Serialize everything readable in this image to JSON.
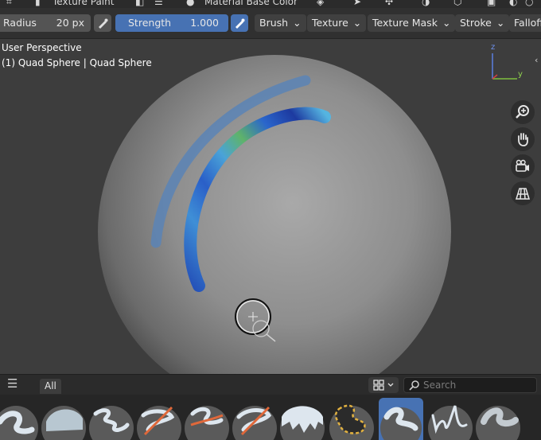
{
  "topbar": {
    "mode": "Texture Paint",
    "source": "Material Base Color"
  },
  "header": {
    "radius_label": "Radius",
    "radius_value": "20 px",
    "strength_label": "Strength",
    "strength_value": "1.000",
    "menus": [
      "Brush",
      "Texture",
      "Texture Mask",
      "Stroke",
      "Falloff"
    ]
  },
  "viewport": {
    "perspective": "User Perspective",
    "object": "(1) Quad Sphere | Quad Sphere",
    "gizmo": {
      "z": "z",
      "y": "y"
    },
    "nav_icons": [
      "zoom-icon",
      "hand-pan-icon",
      "camera-icon",
      "grid-ortho-icon"
    ]
  },
  "shelf": {
    "tab": "All",
    "search_placeholder": "Search",
    "brush_count": 11,
    "selected_index": 7
  },
  "colors": {
    "accent": "#4772b3",
    "header_bg": "#303030",
    "viewport_bg": "#3d3d3d",
    "paint_dark_blue": "#1d3aa0",
    "paint_light_blue": "#4aa3d8",
    "paint_green": "#5fb36a"
  }
}
